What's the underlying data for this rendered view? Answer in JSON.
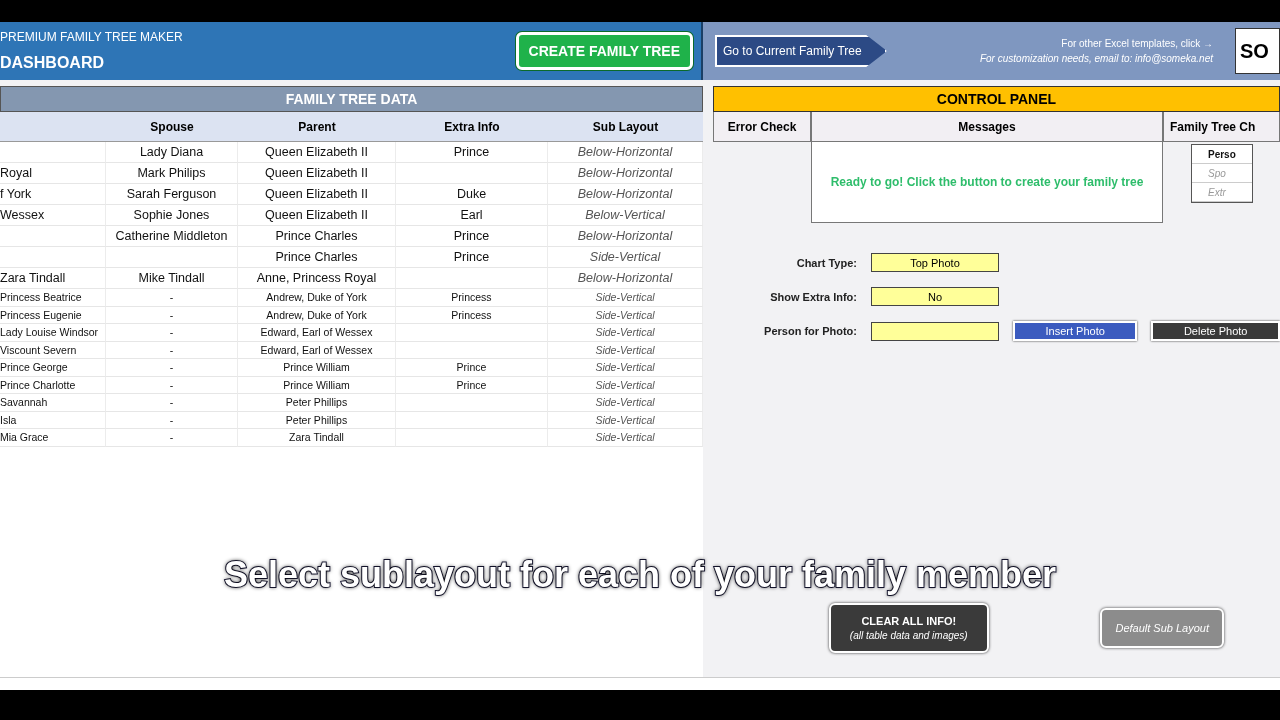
{
  "header": {
    "subtitle": "PREMIUM FAMILY TREE MAKER",
    "title": "DASHBOARD",
    "create_button": "CREATE FAMILY TREE",
    "goto_button": "Go to Current Family Tree",
    "templates_link": "For other Excel templates, click →",
    "contact": "For customization needs, email to: info@someka.net",
    "logo": "SO"
  },
  "table": {
    "title": "FAMILY TREE DATA",
    "columns": [
      "",
      "Spouse",
      "Parent",
      "Extra Info",
      "Sub Layout"
    ],
    "rows": [
      [
        "",
        "Lady Diana",
        "Queen Elizabeth II",
        "Prince",
        "Below-Horizontal"
      ],
      [
        "Royal",
        "Mark Philips",
        "Queen Elizabeth II",
        "",
        "Below-Horizontal"
      ],
      [
        "f York",
        "Sarah Ferguson",
        "Queen Elizabeth II",
        "Duke",
        "Below-Horizontal"
      ],
      [
        "Wessex",
        "Sophie Jones",
        "Queen Elizabeth II",
        "Earl",
        "Below-Vertical"
      ],
      [
        "",
        "Catherine Middleton",
        "Prince Charles",
        "Prince",
        "Below-Horizontal"
      ],
      [
        "",
        "",
        "Prince Charles",
        "Prince",
        "Side-Vertical"
      ],
      [
        "Zara Tindall",
        "Mike Tindall",
        "Anne, Princess Royal",
        "",
        "Below-Horizontal"
      ],
      [
        "Princess Beatrice",
        "-",
        "Andrew, Duke of York",
        "Princess",
        "Side-Vertical"
      ],
      [
        "Princess Eugenie",
        "-",
        "Andrew, Duke of York",
        "Princess",
        "Side-Vertical"
      ],
      [
        "Lady Louise Windsor",
        "-",
        "Edward, Earl of Wessex",
        "",
        "Side-Vertical"
      ],
      [
        "Viscount Severn",
        "-",
        "Edward, Earl of Wessex",
        "",
        "Side-Vertical"
      ],
      [
        "Prince George",
        "-",
        "Prince William",
        "Prince",
        "Side-Vertical"
      ],
      [
        "Prince Charlotte",
        "-",
        "Prince William",
        "Prince",
        "Side-Vertical"
      ],
      [
        "Savannah",
        "-",
        "Peter Phillips",
        "",
        "Side-Vertical"
      ],
      [
        "Isla",
        "-",
        "Peter Phillips",
        "",
        "Side-Vertical"
      ],
      [
        "Mia Grace",
        "-",
        "Zara Tindall",
        "",
        "Side-Vertical"
      ]
    ]
  },
  "control_panel": {
    "title": "CONTROL PANEL",
    "columns": [
      "Error Check",
      "Messages",
      "Family Tree Ch"
    ],
    "message": "Ready to go! Click the button to create your family tree",
    "legend": [
      "Perso",
      "Spo",
      "Extr"
    ],
    "fields": [
      {
        "label": "Chart Type:",
        "value": "Top Photo"
      },
      {
        "label": "Show Extra Info:",
        "value": "No"
      },
      {
        "label": "Person for Photo:"
      }
    ],
    "insert_button": "Insert Photo",
    "delete_button": "Delete Photo",
    "clear_button": {
      "title": "CLEAR ALL INFO!",
      "note": "(all table data and images)"
    },
    "default_button": "Default Sub Layout"
  },
  "caption": "Select sublayout for each of your family member"
}
